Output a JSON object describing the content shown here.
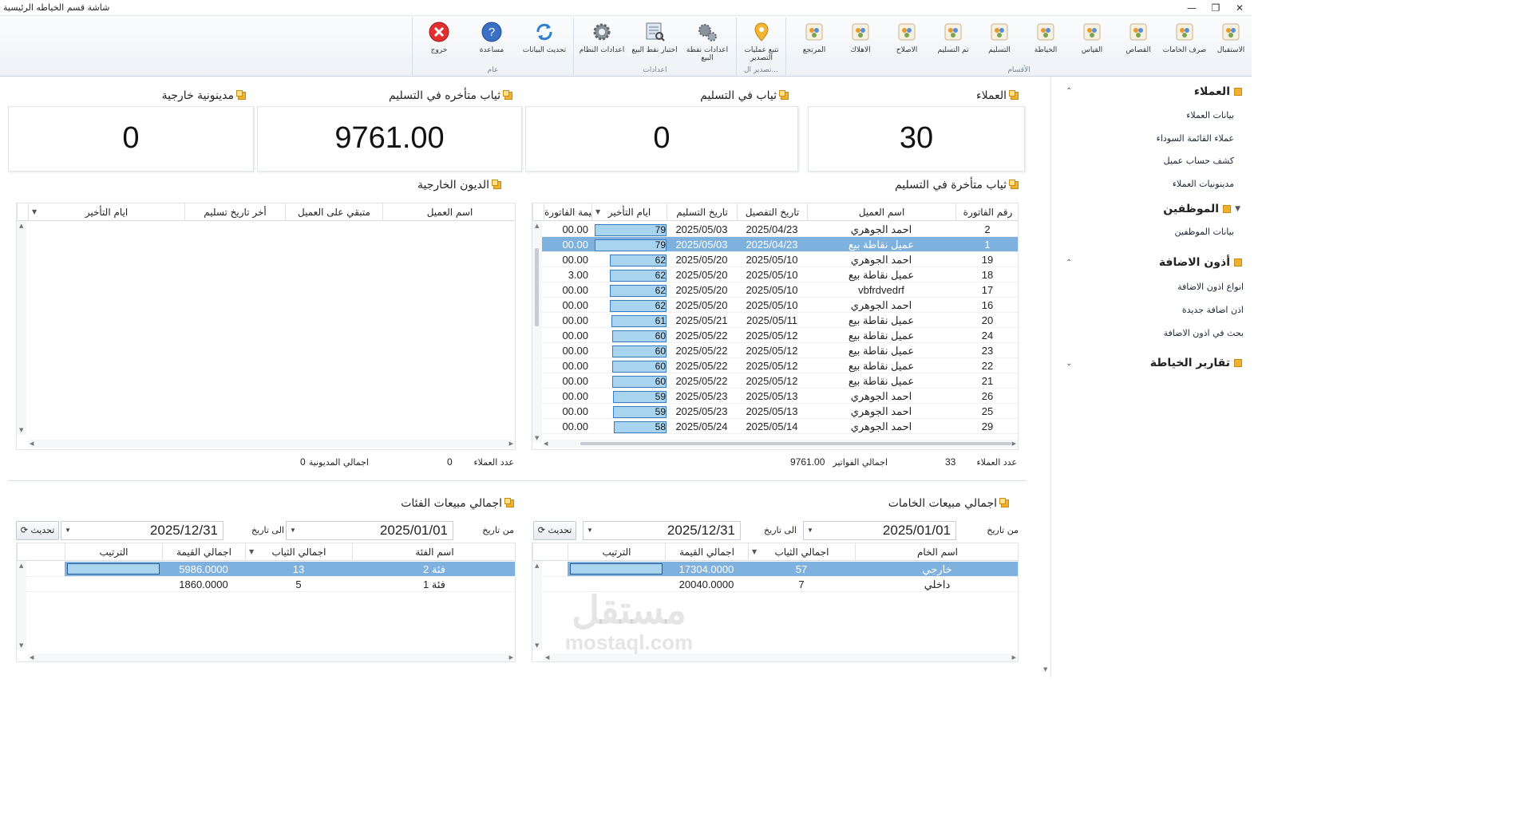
{
  "window": {
    "title": "شاشة قسم الخياطه الرئيسية"
  },
  "ribbon": {
    "groups": {
      "sections": "الأقسام",
      "export": "تصدير ال...",
      "settings": "اعدادات",
      "general": "عام"
    },
    "sections_buttons": [
      "الاستقبال",
      "صرف الخامات",
      "القصاص",
      "القياس",
      "الخياطة",
      "التسليم",
      "تم التسليم",
      "الاصلاح",
      "الاهلاك",
      "المرتجع"
    ],
    "export_buttons": [
      "تتبع عمليات التصدير"
    ],
    "settings_buttons": [
      "اعدادات نقطة البيع",
      "اختبار نقط البيع",
      "اعدادات النظام"
    ],
    "general_buttons": [
      "تحديث البيانات",
      "مساعدة",
      "خروج"
    ]
  },
  "cards": {
    "customers": {
      "label": "العملاء",
      "value": "30"
    },
    "in_delivery": {
      "label": "ثياب في التسليم",
      "value": "0"
    },
    "late_delivery": {
      "label": "ثياب متأخره في التسليم",
      "value": "9761.00"
    },
    "external_debt": {
      "label": "مدينونية خارجية",
      "value": "0"
    }
  },
  "late_grid": {
    "title": "ثياب متأخرة في التسليم",
    "columns": [
      "رقم الفاتورة",
      "اسم العميل",
      "تاريخ التفصيل",
      "تاريخ التسليم",
      "ايام التأخير",
      "قيمة الفاتورة"
    ],
    "rows": [
      [
        "2",
        "احمد الجوهري",
        "2025/04/23",
        "2025/05/03",
        "79",
        "00.00"
      ],
      [
        "1",
        "عميل نقاطة بيع",
        "2025/04/23",
        "2025/05/03",
        "79",
        "00.00"
      ],
      [
        "19",
        "احمد الجوهري",
        "2025/05/10",
        "2025/05/20",
        "62",
        "00.00"
      ],
      [
        "18",
        "عميل نقاطة بيع",
        "2025/05/10",
        "2025/05/20",
        "62",
        "3.00"
      ],
      [
        "17",
        "vbfrdvedrf",
        "2025/05/10",
        "2025/05/20",
        "62",
        "00.00"
      ],
      [
        "16",
        "احمد الجوهري",
        "2025/05/10",
        "2025/05/20",
        "62",
        "00.00"
      ],
      [
        "20",
        "عميل نقاطة بيع",
        "2025/05/11",
        "2025/05/21",
        "61",
        "00.00"
      ],
      [
        "24",
        "عميل نقاطة بيع",
        "2025/05/12",
        "2025/05/22",
        "60",
        "00.00"
      ],
      [
        "23",
        "عميل نقاطة بيع",
        "2025/05/12",
        "2025/05/22",
        "60",
        "00.00"
      ],
      [
        "22",
        "عميل نقاطة بيع",
        "2025/05/12",
        "2025/05/22",
        "60",
        "00.00"
      ],
      [
        "21",
        "عميل نقاطة بيع",
        "2025/05/12",
        "2025/05/22",
        "60",
        "00.00"
      ],
      [
        "26",
        "احمد الجوهري",
        "2025/05/13",
        "2025/05/23",
        "59",
        "00.00"
      ],
      [
        "25",
        "احمد الجوهري",
        "2025/05/13",
        "2025/05/23",
        "59",
        "00.00"
      ],
      [
        "29",
        "احمد الجوهري",
        "2025/05/14",
        "2025/05/24",
        "58",
        "00.00"
      ]
    ],
    "footer": {
      "customers_label": "عدد العملاء",
      "customers_value": "33",
      "total_label": "اجمالي الفواتير",
      "total_value": "9761.00"
    }
  },
  "debt_grid": {
    "title": "الديون الخارجية",
    "columns": [
      "اسم العميل",
      "متبقي على العميل",
      "أخر تاريخ تسليم",
      "ايام التأخير"
    ],
    "footer": {
      "customers_label": "عدد العملاء",
      "customers_value": "0",
      "total_label": "اجمالي المديونية",
      "total_value": "0"
    }
  },
  "materials": {
    "title": "اجمالي مبيعات الخامات",
    "from_label": "من تاريخ",
    "from_value": "2025/01/01",
    "to_label": "الى تاريخ",
    "to_value": "2025/12/31",
    "refresh": "تحديث",
    "columns": [
      "اسم الخام",
      "اجمالي الثياب",
      "اجمالي القيمة",
      "الترتيب"
    ],
    "rows": [
      [
        "خارجي",
        "57",
        "17304.0000",
        ""
      ],
      [
        "داخلي",
        "7",
        "20040.0000",
        ""
      ]
    ]
  },
  "categories": {
    "title": "اجمالي مبيعات الفئات",
    "from_label": "من تاريخ",
    "from_value": "2025/01/01",
    "to_label": "الى تاريخ",
    "to_value": "2025/12/31",
    "refresh": "تحديث",
    "columns": [
      "اسم الفئة",
      "اجمالي الثياب",
      "اجمالي القيمة",
      "الترتيب"
    ],
    "rows": [
      [
        "فئة 2",
        "13",
        "5986.0000",
        ""
      ],
      [
        "فئة 1",
        "5",
        "1860.0000",
        ""
      ]
    ]
  },
  "sidebar": {
    "customers": {
      "title": "العملاء",
      "items": [
        "بيانات العملاء",
        "عملاء القائمة السوداء",
        "كشف حساب عميل",
        "مدينونيات العملاء"
      ]
    },
    "employees": {
      "title": "الموظفين",
      "items": [
        "بيانات الموظفين"
      ]
    },
    "permits": {
      "title": "أذون الاضافة",
      "items": [
        "انواع اذون الاضافة",
        "اذن اضافة جديدة",
        "بحث في اذون الاضافة"
      ]
    },
    "reports": {
      "title": "تقارير الخياطة"
    }
  },
  "watermark": {
    "ar": "مستقل",
    "en": "mostaql.com"
  },
  "colors": {
    "selection": "#7fb1de",
    "days_box": "#a9d4ef",
    "accent": "#f0b030"
  }
}
